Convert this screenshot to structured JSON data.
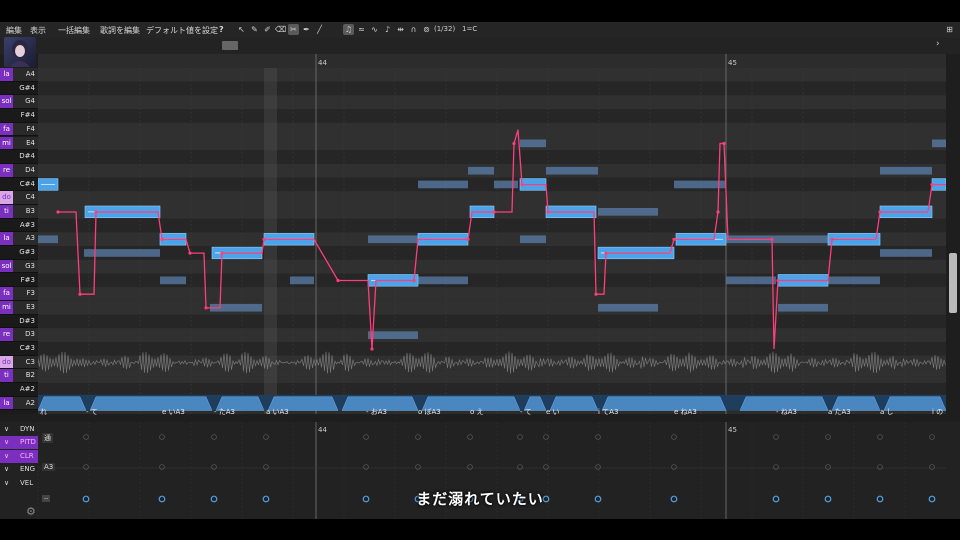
{
  "menu": [
    "編集",
    "表示",
    "一括編集",
    "歌詞を編集",
    "デフォルト値を設定"
  ],
  "help_icon": "?",
  "toolbar": {
    "tools": [
      "cursor-icon",
      "pencil-icon",
      "vibrato-pencil-icon",
      "eraser-icon",
      "scissors-icon",
      "pen-icon",
      "brush-icon",
      "note-icon",
      "wave-icon",
      "curve-icon",
      "line-icon",
      "arrows-icon",
      "arc-icon",
      "headphone-icon"
    ],
    "counter": "(1/32)",
    "key": "1=C"
  },
  "ruler": {
    "bar_a": "44",
    "bar_b": "45"
  },
  "keys": [
    {
      "sol": "la",
      "name": "A4",
      "color": "white"
    },
    {
      "sol": "",
      "name": "G#4",
      "color": "black"
    },
    {
      "sol": "sol",
      "name": "G4",
      "color": "white"
    },
    {
      "sol": "",
      "name": "F#4",
      "color": "black"
    },
    {
      "sol": "fa",
      "name": "F4",
      "color": "white"
    },
    {
      "sol": "mi",
      "name": "E4",
      "color": "white"
    },
    {
      "sol": "",
      "name": "D#4",
      "color": "black"
    },
    {
      "sol": "re",
      "name": "D4",
      "color": "white"
    },
    {
      "sol": "",
      "name": "C#4",
      "color": "black"
    },
    {
      "sol": "do",
      "name": "C4",
      "color": "white"
    },
    {
      "sol": "ti",
      "name": "B3",
      "color": "white"
    },
    {
      "sol": "",
      "name": "A#3",
      "color": "black"
    },
    {
      "sol": "la",
      "name": "A3",
      "color": "white"
    },
    {
      "sol": "",
      "name": "G#3",
      "color": "black"
    },
    {
      "sol": "sol",
      "name": "G3",
      "color": "white"
    },
    {
      "sol": "",
      "name": "F#3",
      "color": "black"
    },
    {
      "sol": "fa",
      "name": "F3",
      "color": "white"
    },
    {
      "sol": "mi",
      "name": "E3",
      "color": "white"
    },
    {
      "sol": "",
      "name": "D#3",
      "color": "black"
    },
    {
      "sol": "re",
      "name": "D3",
      "color": "white"
    },
    {
      "sol": "",
      "name": "C#3",
      "color": "black"
    },
    {
      "sol": "do",
      "name": "C3",
      "color": "white"
    },
    {
      "sol": "ti",
      "name": "B2",
      "color": "white"
    },
    {
      "sol": "",
      "name": "A#2",
      "color": "black"
    },
    {
      "sol": "la",
      "name": "A2",
      "color": "white"
    }
  ],
  "lyrics": [
    "れ",
    "- て",
    "e いA3",
    "- たA3",
    "a いA3",
    "- おA3",
    "o ぼA3",
    "o え",
    "- て",
    "e い",
    "i てA3",
    "e ねA3",
    "- ねA3",
    "a たA3",
    "a し",
    "i の"
  ],
  "params": [
    {
      "label": "DYN",
      "active": false
    },
    {
      "label": "PITD",
      "active": true
    },
    {
      "label": "CLR",
      "active": true
    },
    {
      "label": "ENG",
      "active": false
    },
    {
      "label": "VEL",
      "active": false
    }
  ],
  "param_tags": {
    "pitd": "通",
    "eng": "A3",
    "vel": "--"
  },
  "subtitle": "まだ溺れていたい",
  "colors": {
    "accent": "#7b2fbe",
    "note": "#4da3e8",
    "pitch": "#ff3d7a",
    "note_dim": "#6a8fb8"
  }
}
